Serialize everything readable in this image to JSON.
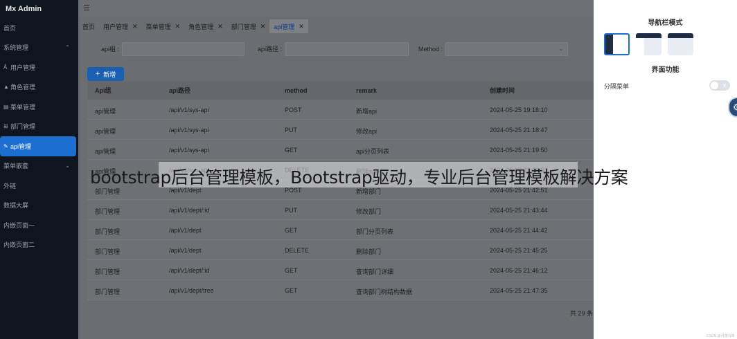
{
  "sidebar": {
    "brand": "Mx Admin",
    "items": [
      {
        "label": "首页",
        "icon": "",
        "chevron": ""
      },
      {
        "label": "系统管理",
        "icon": "",
        "chevron": "^"
      },
      {
        "label": "用户管理",
        "icon": "user-icon",
        "chevron": ""
      },
      {
        "label": "角色管理",
        "icon": "role-icon",
        "chevron": ""
      },
      {
        "label": "菜单管理",
        "icon": "menu-icon",
        "chevron": ""
      },
      {
        "label": "部门管理",
        "icon": "dept-icon",
        "chevron": ""
      },
      {
        "label": "api管理",
        "icon": "api-icon",
        "chevron": ""
      },
      {
        "label": "菜单嵌套",
        "icon": "",
        "chevron": "v"
      },
      {
        "label": "外链",
        "icon": "",
        "chevron": ""
      },
      {
        "label": "数据大屏",
        "icon": "",
        "chevron": ""
      },
      {
        "label": "内嵌页面一",
        "icon": "",
        "chevron": ""
      },
      {
        "label": "内嵌页面二",
        "icon": "",
        "chevron": ""
      }
    ]
  },
  "tabs": [
    {
      "label": "首页",
      "closable": false
    },
    {
      "label": "用户管理",
      "closable": true
    },
    {
      "label": "菜单管理",
      "closable": true
    },
    {
      "label": "角色管理",
      "closable": true
    },
    {
      "label": "部门管理",
      "closable": true
    },
    {
      "label": "api管理",
      "closable": true
    }
  ],
  "filters": {
    "group_label": "api组 :",
    "path_label": "api路径 :",
    "method_label": "Method :"
  },
  "add_button": "新增",
  "table": {
    "headers": [
      "Api组",
      "api路径",
      "method",
      "remark",
      "创建时间"
    ],
    "rows": [
      [
        "api管理",
        "/api/v1/sys-api",
        "POST",
        "新增api",
        "2024-05-25 19:18:10"
      ],
      [
        "api管理",
        "/api/v1/sys-api",
        "PUT",
        "修改api",
        "2024-05-25 21:18:47"
      ],
      [
        "api管理",
        "/api/v1/sys-api",
        "GET",
        "api分页列表",
        "2024-05-25 21:19:50"
      ],
      [
        "api管理",
        "/api/v1/sys-api",
        "DELETE",
        "删除api",
        "2024-05-25 21:20:33"
      ],
      [
        "部门管理",
        "/api/v1/dept",
        "POST",
        "新增部门",
        "2024-05-25 21:42:51"
      ],
      [
        "部门管理",
        "/api/v1/dept/:id",
        "PUT",
        "修改部门",
        "2024-05-25 21:43:44"
      ],
      [
        "部门管理",
        "/api/v1/dept",
        "GET",
        "部门分页列表",
        "2024-05-25 21:44:42"
      ],
      [
        "部门管理",
        "/api/v1/dept",
        "DELETE",
        "删除部门",
        "2024-05-25 21:45:25"
      ],
      [
        "部门管理",
        "/api/v1/dept/:id",
        "GET",
        "查询部门详细",
        "2024-05-25 21:46:12"
      ],
      [
        "部门管理",
        "/api/v1/dept/tree",
        "GET",
        "查询部门树结构数据",
        "2024-05-25 21:47:35"
      ]
    ],
    "total": "共 29 条"
  },
  "drawer": {
    "nav_mode_title": "导航栏模式",
    "ui_function_title": "界面功能",
    "split_menu_label": "分隔菜单",
    "toggle_label": "关",
    "corner_text": "CSDN @月落乌啼"
  },
  "caption": "bootstrap后台管理模板，Bootstrap驱动，专业后台管理模板解决方案",
  "colors": {
    "accent": "#1c6fd0",
    "sidebar_bg": "#0f151e",
    "drawer_bg": "#ffffff"
  }
}
